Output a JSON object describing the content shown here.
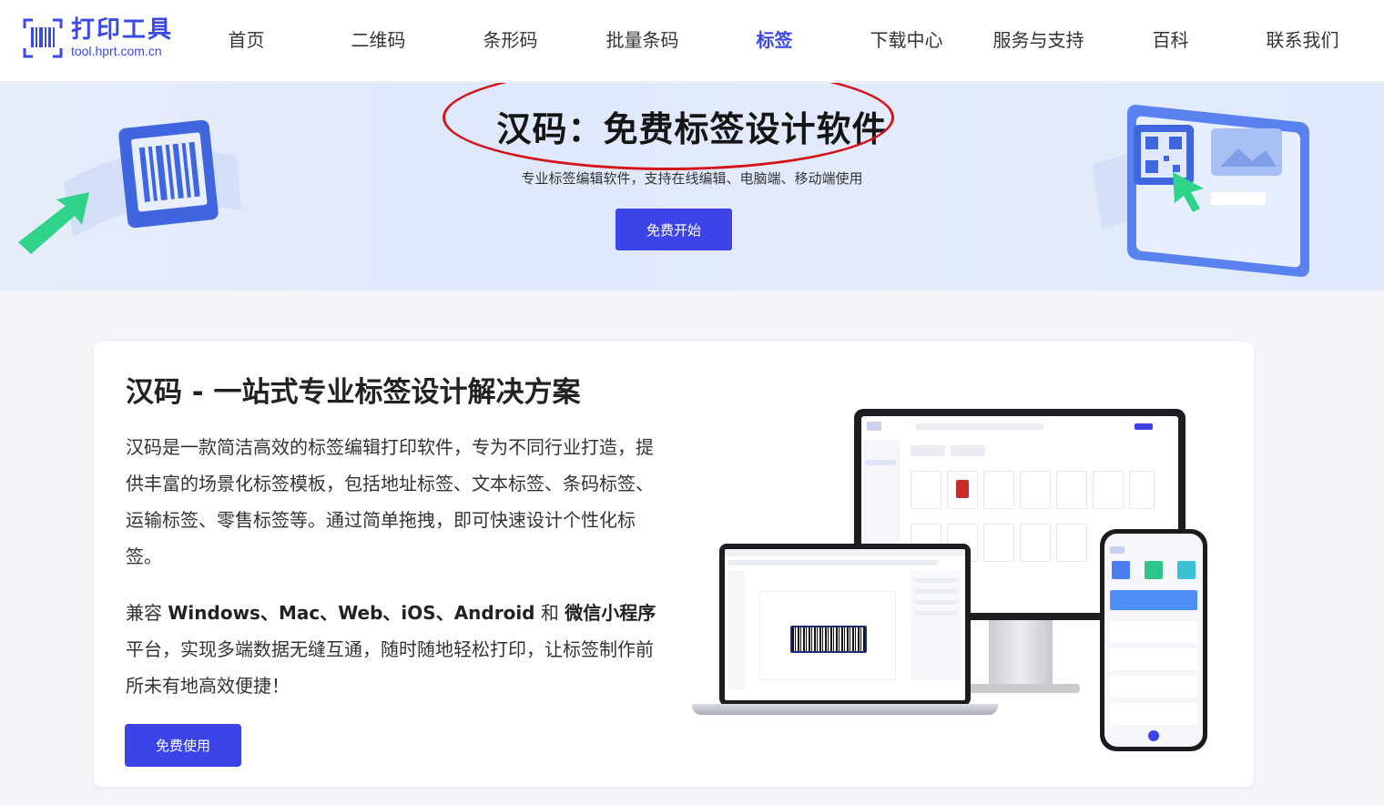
{
  "logo": {
    "title": "打印工具",
    "subtitle": "tool.hprt.com.cn"
  },
  "nav": [
    {
      "label": "首页"
    },
    {
      "label": "二维码"
    },
    {
      "label": "条形码"
    },
    {
      "label": "批量条码"
    },
    {
      "label": "标签",
      "active": true
    },
    {
      "label": "下载中心"
    },
    {
      "label": "服务与支持"
    },
    {
      "label": "百科"
    },
    {
      "label": "联系我们"
    }
  ],
  "hero": {
    "title": "汉码：免费标签设计软件",
    "subtitle": "专业标签编辑软件，支持在线编辑、电脑端、移动端使用",
    "button": "免费开始"
  },
  "card": {
    "title": "汉码 - 一站式专业标签设计解决方案",
    "paragraph1": "汉码是一款简洁高效的标签编辑打印软件，专为不同行业打造，提供丰富的场景化标签模板，包括地址标签、文本标签、条码标签、运输标签、零售标签等。通过简单拖拽，即可快速设计个性化标签。",
    "p2_prefix": "兼容 ",
    "p2_platforms": "Windows、Mac、Web、iOS、Android",
    "p2_and": " 和 ",
    "p2_mini": "微信小程序",
    "p2_suffix": " 平台，实现多端数据无缝互通，随时随地轻松打印，让标签制作前所未有地高效便捷！",
    "button": "免费使用"
  },
  "colors": {
    "brand": "#3a49e6",
    "button": "#3c44e8",
    "highlight_ellipse": "#d4141b"
  }
}
